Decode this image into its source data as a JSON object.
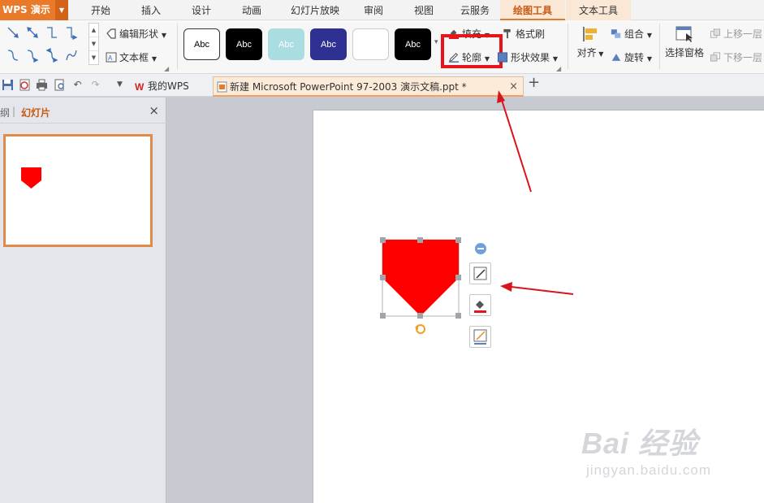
{
  "menubar": {
    "app_name": "WPS 演示",
    "tabs": [
      {
        "label": "开始"
      },
      {
        "label": "插入"
      },
      {
        "label": "设计"
      },
      {
        "label": "动画"
      },
      {
        "label": "幻灯片放映"
      },
      {
        "label": "审阅"
      },
      {
        "label": "视图"
      },
      {
        "label": "云服务"
      },
      {
        "label": "绘图工具"
      },
      {
        "label": "文本工具"
      }
    ],
    "active_tab": "绘图工具"
  },
  "ribbon": {
    "edit_shape": "编辑形状",
    "text_box": "文本框",
    "style_label": "Abc",
    "styles": [
      {
        "fill": "#ffffff",
        "border": "#333333",
        "text": "#000000"
      },
      {
        "fill": "#000000",
        "border": "#000000",
        "text": "#ffffff"
      },
      {
        "fill": "#a9dde0",
        "border": "#a9dde0",
        "text": "#ffffff"
      },
      {
        "fill": "#2e3192",
        "border": "#2e3192",
        "text": "#ffffff"
      },
      {
        "fill": "#ffffff",
        "border": "#cccccc",
        "text": "#ffffff"
      },
      {
        "fill": "#000000",
        "border": "#000000",
        "text": "#ffffff"
      }
    ],
    "fill": "填充",
    "format_painter": "格式刷",
    "outline": "轮廓",
    "shape_effects": "形状效果",
    "align": "对齐",
    "group": "组合",
    "rotate": "旋转",
    "selection_pane": "选择窗格",
    "bring_forward": "上移一层",
    "send_backward": "下移一层"
  },
  "tabbar": {
    "wps_tab": "我的WPS",
    "doc_tab": "新建 Microsoft PowerPoint 97-2003 演示文稿.ppt *"
  },
  "leftpanel": {
    "outline_label": "纲",
    "slides_label": "幻灯片"
  },
  "colors": {
    "accent_orange": "#e97a2a",
    "shape_fill": "#ff0000",
    "highlight_red": "#e8141b"
  },
  "watermark": {
    "logo": "Bai 经验",
    "url": "jingyan.baidu.com"
  }
}
